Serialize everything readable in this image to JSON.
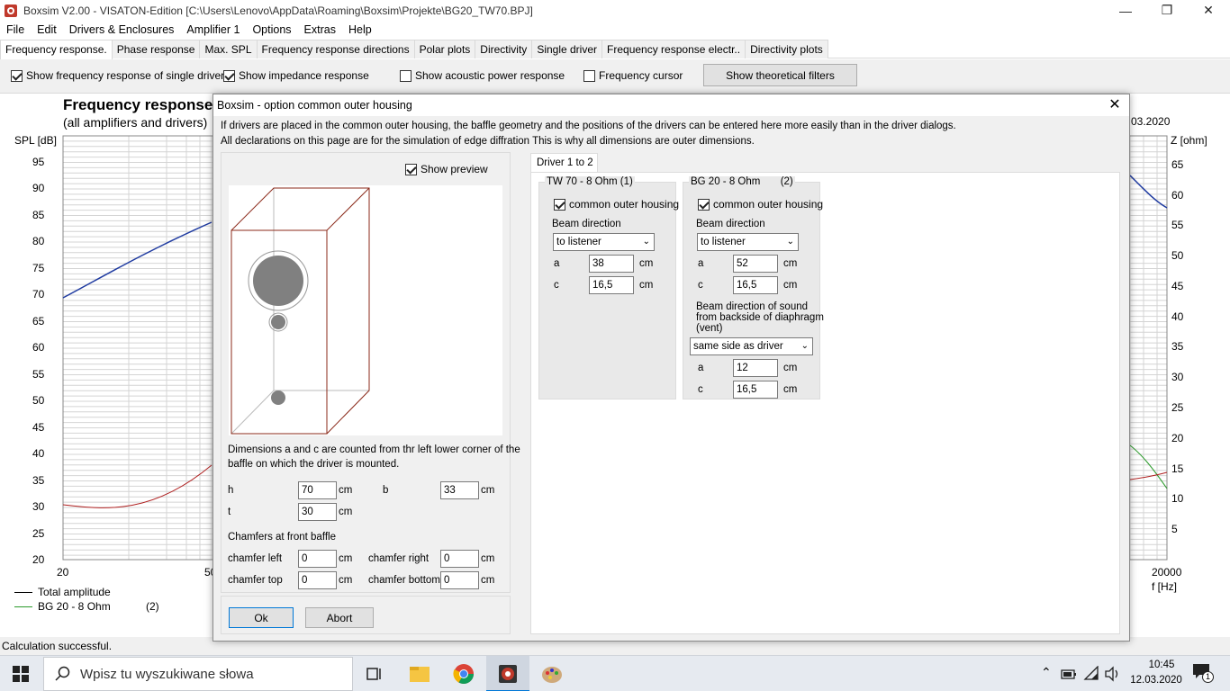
{
  "window": {
    "title": "Boxsim V2.00 - VISATON-Edition [C:\\Users\\Lenovo\\AppData\\Roaming\\Boxsim\\Projekte\\BG20_TW70.BPJ]"
  },
  "menu": [
    "File",
    "Edit",
    "Drivers & Enclosures",
    "Amplifier 1",
    "Options",
    "Extras",
    "Help"
  ],
  "tabs": [
    "Frequency response.",
    "Phase response",
    "Max. SPL",
    "Frequency response directions",
    "Polar plots",
    "Directivity",
    "Single driver",
    "Frequency response electr..",
    "Directivity plots"
  ],
  "options": {
    "single_driver": "Show frequency response of single driver",
    "impedance": "Show impedance response",
    "acoustic_power": "Show acoustic power response",
    "cursor": "Frequency cursor",
    "theoretical_filters": "Show theoretical filters"
  },
  "plot": {
    "title": "Frequency response",
    "subtitle": "(all amplifiers and drivers)",
    "date": "03.2020",
    "ylabel_left": "SPL [dB]",
    "ylabel_right": "Z [ohm]",
    "xlabel": "f [Hz]",
    "y_ticks_left": [
      "95",
      "90",
      "85",
      "80",
      "75",
      "70",
      "65",
      "60",
      "55",
      "50",
      "45",
      "40",
      "35",
      "30",
      "25",
      "20"
    ],
    "y_ticks_right": [
      "65",
      "60",
      "55",
      "50",
      "45",
      "40",
      "35",
      "30",
      "25",
      "20",
      "15",
      "10",
      "5"
    ],
    "x_ticks": [
      "20",
      "50",
      "20000"
    ],
    "legend": [
      {
        "label": "Total amplitude",
        "index": ""
      },
      {
        "label": "BG 20 - 8 Ohm",
        "index": "(2)"
      }
    ]
  },
  "status": "Calculation successful.",
  "dialog": {
    "title": "Boxsim - option common outer housing",
    "info1": "If drivers are placed in the common outer housing,  the baffle geometry and the positions of the drivers can be entered here more easily than in the driver dialogs.",
    "info2": "All declarations on this page are for the simulation of edge diffration This is why all dimensions are outer dimensions.",
    "show_preview": "Show preview",
    "dims_note_1": "Dimensions a and c are counted from thr left lower corner of the",
    "dims_note_2": "baffle on which the driver is mounted.",
    "h_label": "h",
    "h_value": "70",
    "b_label": "b",
    "b_value": "33",
    "t_label": "t",
    "t_value": "30",
    "unit": "cm",
    "chamfers_title": "Chamfers at front baffle",
    "chamfer_left_label": "chamfer left",
    "chamfer_left": "0",
    "chamfer_right_label": "chamfer right",
    "chamfer_right": "0",
    "chamfer_top_label": "chamfer top",
    "chamfer_top": "0",
    "chamfer_bottom_label": "chamfer bottom",
    "chamfer_bottom": "0",
    "ok": "Ok",
    "abort": "Abort",
    "driver_tab": "Driver 1 to 2",
    "driver1": {
      "title": "TW 70 - 8 Ohm (1)",
      "housing": "common outer housing",
      "beam_label": "Beam direction",
      "beam_value": "to listener",
      "a_label": "a",
      "a": "38",
      "c_label": "c",
      "c": "16,5"
    },
    "driver2": {
      "title": "BG 20 - 8 Ohm       (2)",
      "housing": "common outer housing",
      "beam_label": "Beam direction",
      "beam_value": "to listener",
      "a_label": "a",
      "a": "52",
      "c_label": "c",
      "c": "16,5",
      "back_label_1": "Beam direction of sound",
      "back_label_2": "from backside of diaphragm",
      "back_label_3": "(vent)",
      "back_value": "same side as driver",
      "a2_label": "a",
      "a2": "12",
      "c2_label": "c",
      "c2": "16,5"
    }
  },
  "taskbar": {
    "search_placeholder": "Wpisz tu wyszukiwane słowa",
    "time": "10:45",
    "date": "12.03.2020",
    "notifications": "1"
  }
}
